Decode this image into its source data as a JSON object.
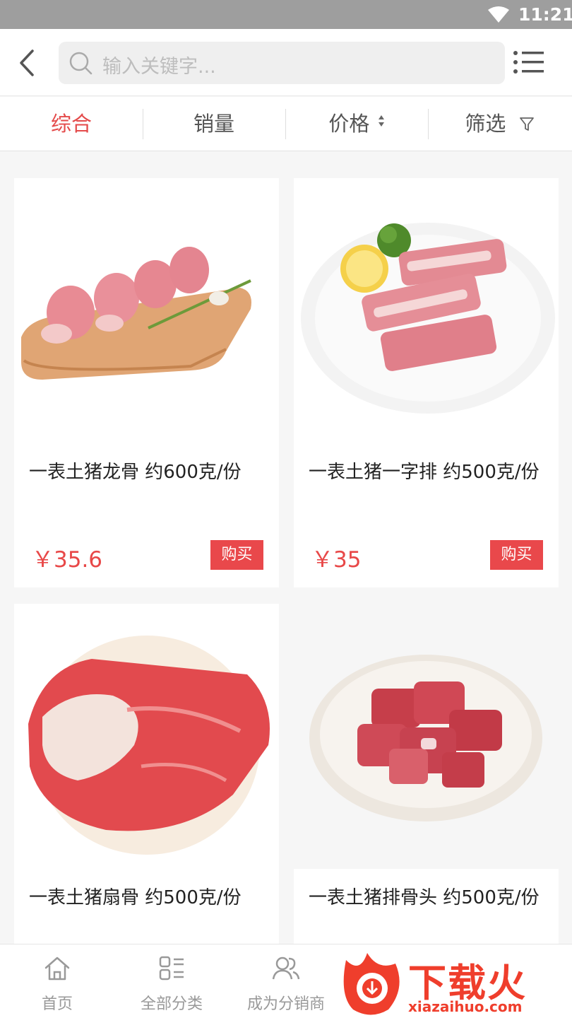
{
  "status_bar": {
    "time": "11:21"
  },
  "search": {
    "placeholder": "输入关键字..."
  },
  "sort_tabs": [
    {
      "label": "综合",
      "active": true
    },
    {
      "label": "销量",
      "active": false
    },
    {
      "label": "价格",
      "active": false
    },
    {
      "label": "筛选",
      "active": false
    }
  ],
  "products": [
    {
      "name": "一表土猪龙骨 约600克/份",
      "price": "￥35.6",
      "buy_label": "购买"
    },
    {
      "name": "一表土猪一字排 约500克/份",
      "price": "￥35",
      "buy_label": "购买"
    },
    {
      "name": "一表土猪扇骨 约500克/份"
    },
    {
      "name": "一表土猪排骨头 约500克/份"
    }
  ],
  "bottom_nav": [
    {
      "label": "首页",
      "icon": "home-icon"
    },
    {
      "label": "全部分类",
      "icon": "category-icon"
    },
    {
      "label": "成为分销商",
      "icon": "users-icon"
    }
  ],
  "watermark": {
    "text": "下载火",
    "url": "xiazaihuo.com"
  },
  "colors": {
    "accent": "#e84848",
    "status_bar": "#9e9e9e"
  }
}
